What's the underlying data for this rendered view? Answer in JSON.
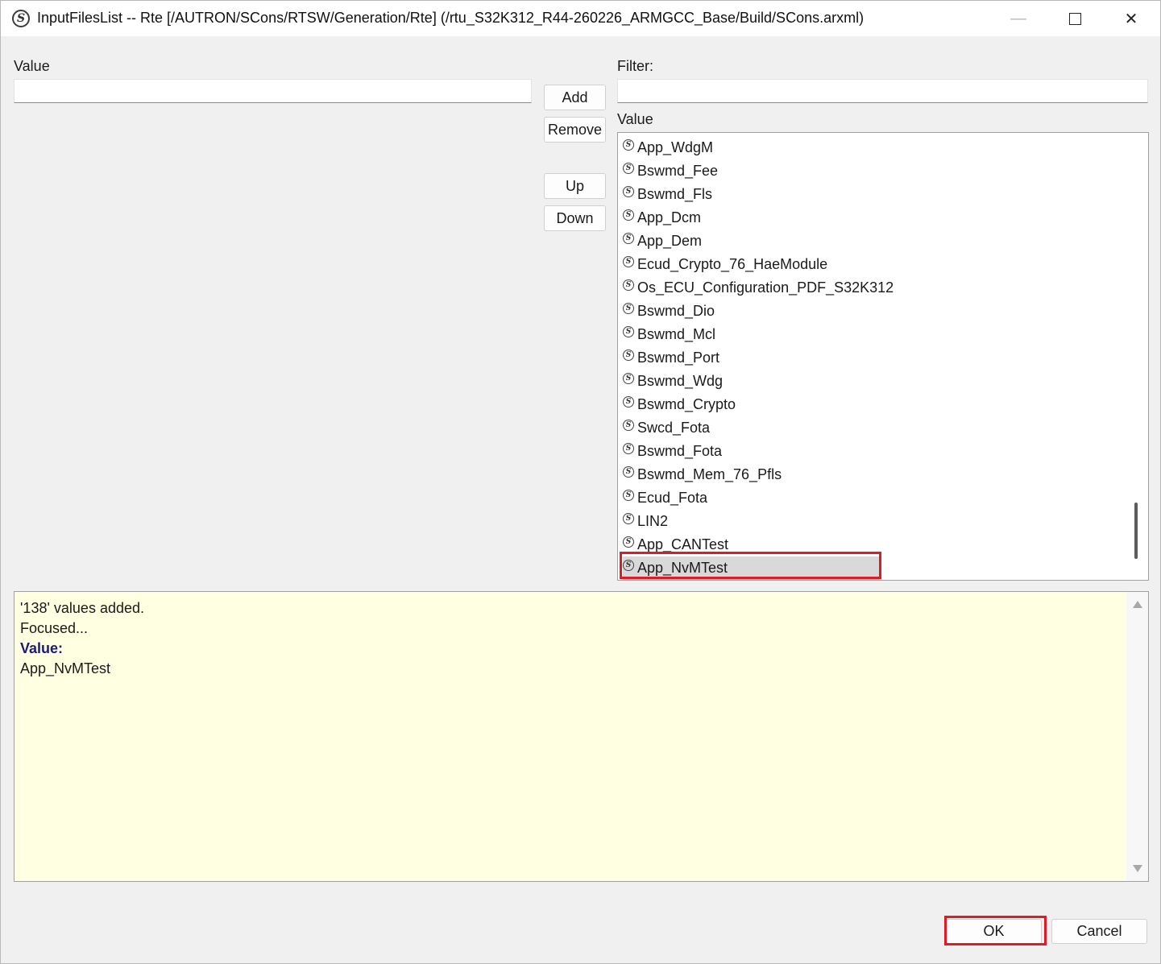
{
  "window": {
    "title": "InputFilesList -- Rte [/AUTRON/SCons/RTSW/Generation/Rte] (/rtu_S32K312_R44-260226_ARMGCC_Base/Build/SCons.arxml)",
    "app_icon_glyph": "S",
    "minimize_glyph": "—",
    "close_glyph": "✕"
  },
  "left": {
    "value_label": "Value",
    "value_input": ""
  },
  "buttons": {
    "add": "Add",
    "remove": "Remove",
    "up": "Up",
    "down": "Down"
  },
  "right": {
    "filter_label": "Filter:",
    "filter_input": "",
    "list_header": "Value",
    "items": [
      "App_WdgM",
      "Bswmd_Fee",
      "Bswmd_Fls",
      "App_Dcm",
      "App_Dem",
      "Ecud_Crypto_76_HaeModule",
      "Os_ECU_Configuration_PDF_S32K312",
      "Bswmd_Dio",
      "Bswmd_Mcl",
      "Bswmd_Port",
      "Bswmd_Wdg",
      "Bswmd_Crypto",
      "Swcd_Fota",
      "Bswmd_Fota",
      "Bswmd_Mem_76_Pfls",
      "Ecud_Fota",
      "LIN2",
      "App_CANTest",
      "App_NvMTest"
    ],
    "selected_item": "App_NvMTest"
  },
  "info": {
    "line1": "'138' values added.",
    "line2": "Focused...",
    "line3": "Value:",
    "line4": "App_NvMTest"
  },
  "dialog": {
    "ok": "OK",
    "cancel": "Cancel"
  },
  "colors": {
    "highlight": "#e01b24",
    "info_background": "#ffffe1",
    "selection": "#d9d9d9"
  }
}
